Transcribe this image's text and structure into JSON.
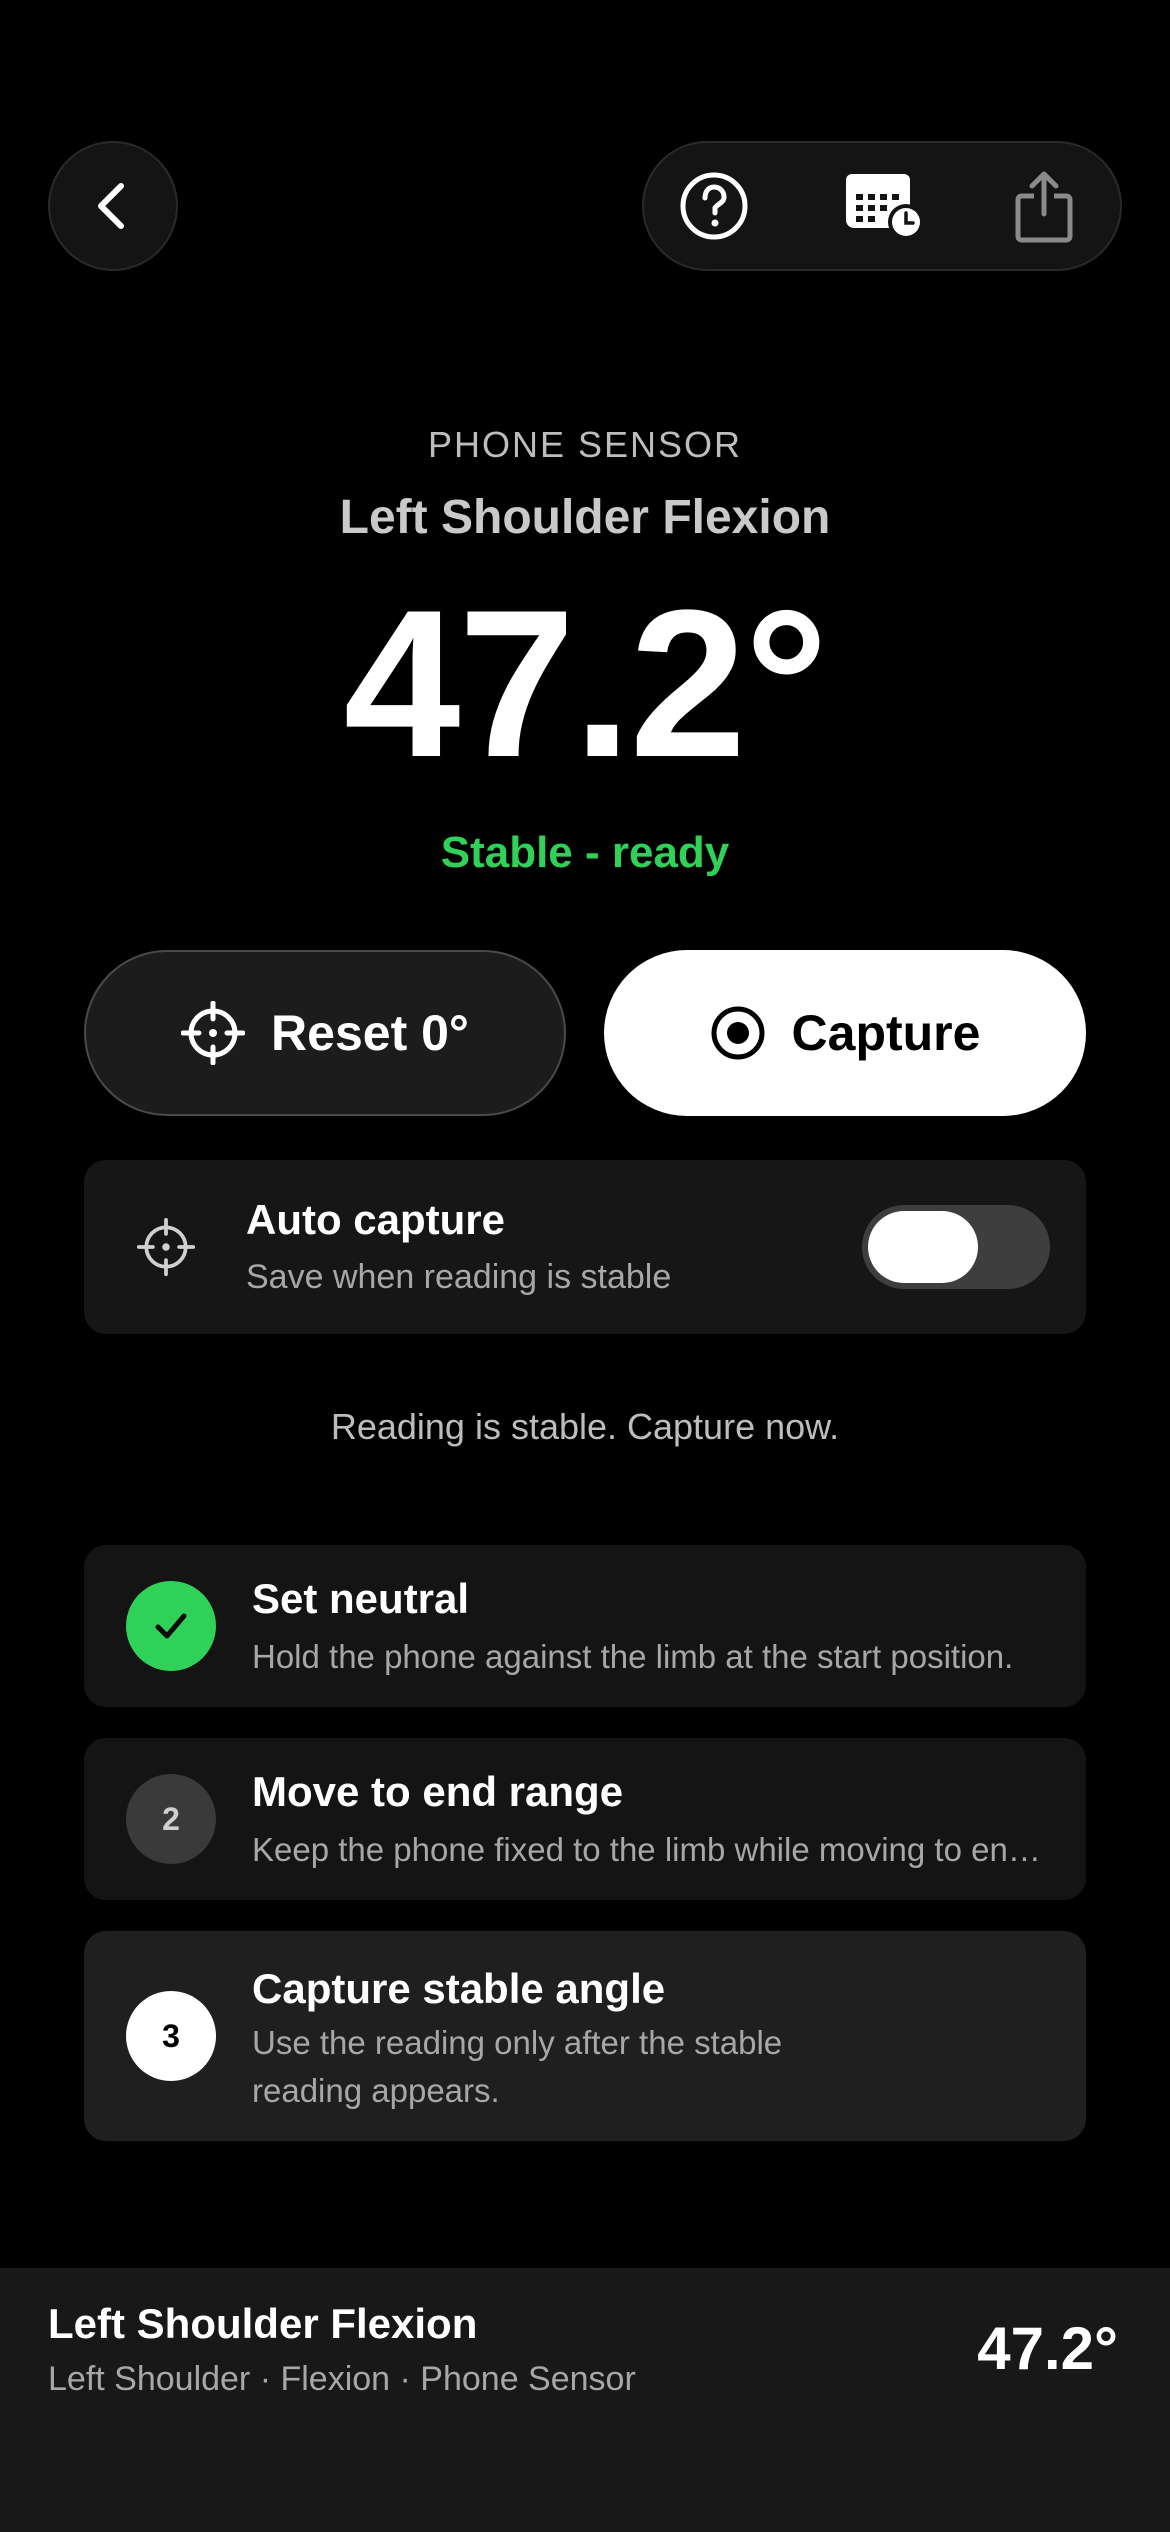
{
  "colors": {
    "accent_green": "#30d158",
    "background": "#000000",
    "card": "#161616",
    "muted_text": "#a7a7a7"
  },
  "header": {
    "back_icon": "chevron-left-icon",
    "tools": [
      {
        "name": "help",
        "icon": "question-circle-icon"
      },
      {
        "name": "history",
        "icon": "calendar-clock-icon"
      },
      {
        "name": "share",
        "icon": "share-icon"
      }
    ]
  },
  "reading": {
    "source": "PHONE SENSOR",
    "exercise": "Left Shoulder Flexion",
    "angle": "47.2°",
    "status": "Stable - ready"
  },
  "actions": {
    "reset_label": "Reset 0°",
    "reset_icon": "crosshair-icon",
    "capture_label": "Capture",
    "capture_icon": "record-icon"
  },
  "auto_capture": {
    "icon": "crosshair-icon",
    "title": "Auto capture",
    "subtitle": "Save when reading is stable",
    "enabled": false
  },
  "hint": "Reading is stable. Capture now.",
  "steps": [
    {
      "badge": "✓",
      "state": "done",
      "title": "Set neutral",
      "description": "Hold the phone against the limb at the start position."
    },
    {
      "badge": "2",
      "state": "pending",
      "title": "Move to end range",
      "description": "Keep the phone fixed to the limb while moving to end range."
    },
    {
      "badge": "3",
      "state": "current",
      "title": "Capture stable angle",
      "description": "Use the reading only after the stable reading appears."
    }
  ],
  "summary": {
    "title": "Left Shoulder Flexion",
    "meta": "Left Shoulder · Flexion · Phone Sensor",
    "angle": "47.2°"
  }
}
